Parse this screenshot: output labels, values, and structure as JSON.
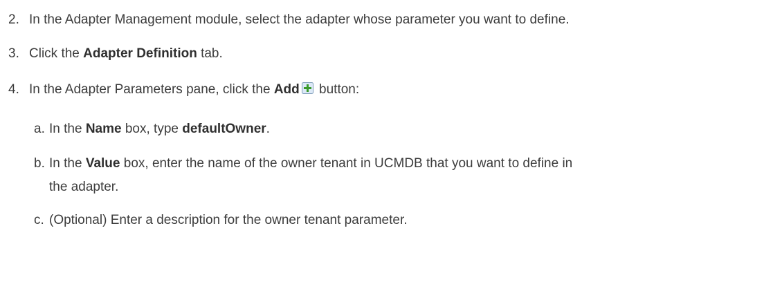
{
  "steps": [
    {
      "number": "2.",
      "text": "In the Adapter Management module, select the adapter whose parameter you want to define."
    },
    {
      "number": "3.",
      "pre": "Click the ",
      "bold": "Adapter Definition",
      "post": " tab."
    },
    {
      "number": "4.",
      "pre": "In the Adapter Parameters pane, click the ",
      "bold": "Add",
      "icon": "add-plus-icon",
      "post": " button:",
      "substeps": [
        {
          "letter": "a.",
          "pre": "In the ",
          "bold1": "Name",
          "mid": " box, type ",
          "bold2": "defaultOwner",
          "post": "."
        },
        {
          "letter": "b.",
          "pre": "In the ",
          "bold": "Value",
          "post": " box, enter the name of the owner tenant in UCMDB that you want to define in",
          "continuation": "the adapter."
        },
        {
          "letter": "c.",
          "text": "(Optional) Enter a description for the owner tenant parameter."
        }
      ]
    }
  ],
  "colors": {
    "text": "#3c3c3c",
    "icon_fill": "#dce9f7",
    "icon_plus": "#3a9a2a"
  }
}
